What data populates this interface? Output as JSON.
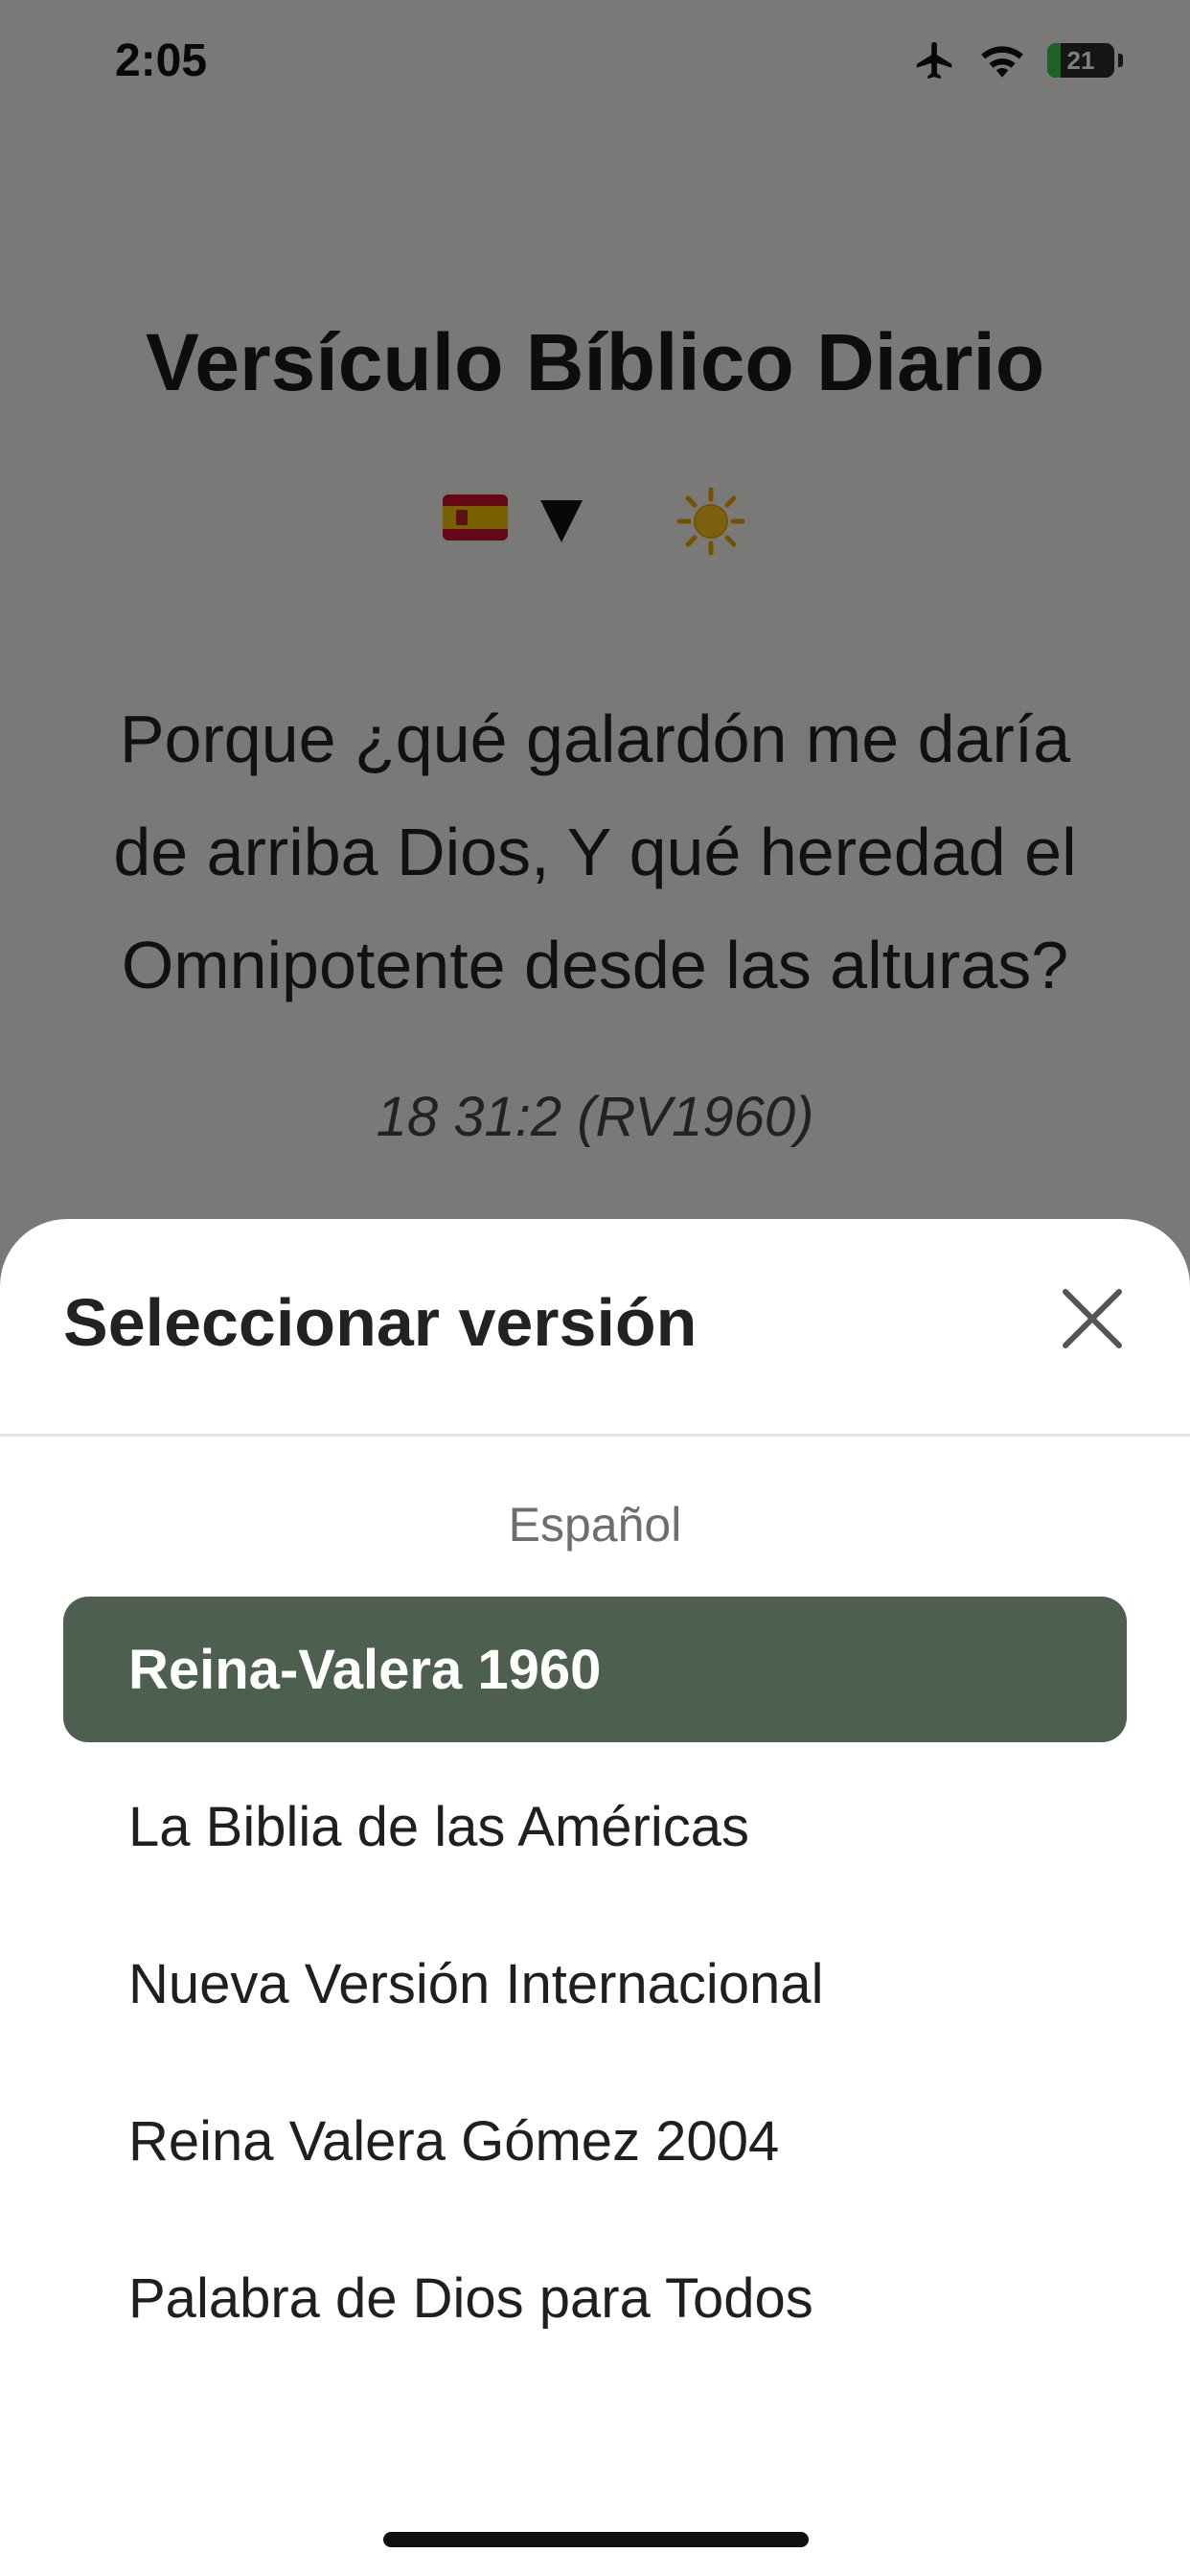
{
  "status_bar": {
    "time": "2:05",
    "battery": "21"
  },
  "app": {
    "title": "Versículo Bíblico Diario",
    "verse": "Porque  ¿qué galardón me daría de arriba Dios, Y qué heredad el Omnipotente desde las alturas?",
    "reference": "18 31:2 (RV1960)"
  },
  "sheet": {
    "title": "Seleccionar versión",
    "section_label": "Español",
    "versions": [
      {
        "label": "Reina-Valera 1960",
        "selected": true
      },
      {
        "label": "La Biblia de las Américas",
        "selected": false
      },
      {
        "label": "Nueva Versión Internacional",
        "selected": false
      },
      {
        "label": "Reina Valera Gómez 2004",
        "selected": false
      },
      {
        "label": "Palabra de Dios para Todos",
        "selected": false
      }
    ]
  },
  "colors": {
    "selected_bg": "#4d6050",
    "overlay": "rgba(0,0,0,0.5)"
  },
  "icons": [
    "airplane-icon",
    "wifi-icon",
    "battery-icon",
    "spain-flag-icon",
    "dropdown-triangle-icon",
    "sun-icon",
    "close-icon"
  ]
}
